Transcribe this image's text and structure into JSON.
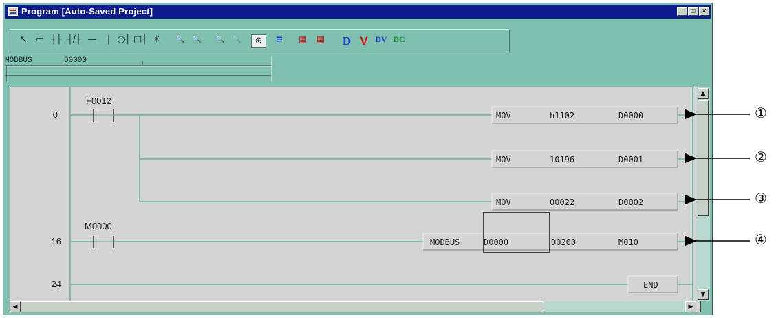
{
  "window": {
    "title": "Program  [Auto-Saved Project]",
    "controls": [
      "minimize-icon",
      "maximize-icon",
      "close-icon"
    ],
    "control_glyphs": [
      "_",
      "□",
      "×"
    ]
  },
  "toolbar": {
    "tools": [
      {
        "name": "select-pointer-icon",
        "glyph": "↖"
      },
      {
        "name": "box-select-icon",
        "glyph": "▭"
      },
      {
        "name": "no-contact-icon",
        "glyph": "┤├"
      },
      {
        "name": "nc-contact-icon",
        "glyph": "┤/├"
      },
      {
        "name": "horizontal-line-icon",
        "glyph": "—"
      },
      {
        "name": "vertical-line-icon",
        "glyph": "|"
      },
      {
        "name": "coil-icon",
        "glyph": "○┤"
      },
      {
        "name": "function-box-icon",
        "glyph": "□┤"
      },
      {
        "name": "invert-icon",
        "glyph": "✳"
      },
      {
        "name": "zoom-in-icon",
        "glyph": "🔍"
      },
      {
        "name": "zoom-out-icon",
        "glyph": "🔍"
      },
      {
        "name": "zoom-fit-icon",
        "glyph": "🔍"
      },
      {
        "name": "zoom-reset-icon",
        "glyph": "🔍"
      },
      {
        "name": "zoom-select-icon",
        "glyph": "⊕"
      },
      {
        "name": "comment-icon",
        "glyph": "≡"
      },
      {
        "name": "monitor-on-icon",
        "glyph": "▦"
      },
      {
        "name": "monitor-off-icon",
        "glyph": "▦"
      },
      {
        "name": "device-d-icon",
        "glyph": "D"
      },
      {
        "name": "device-v-icon",
        "glyph": "V"
      },
      {
        "name": "device-dv-icon",
        "glyph": "DV"
      },
      {
        "name": "device-dc-icon",
        "glyph": "DC"
      }
    ]
  },
  "mod_bar": {
    "instruction": "MODBUS",
    "operand": "D0000"
  },
  "ladder": {
    "rungs": [
      {
        "step": "0",
        "contact": "F0012",
        "instructions": [
          {
            "op": "MOV",
            "src": "h1102",
            "dst": "D0000"
          },
          {
            "op": "MOV",
            "src": "10196",
            "dst": "D0001"
          },
          {
            "op": "MOV",
            "src": "00022",
            "dst": "D0002"
          }
        ]
      },
      {
        "step": "16",
        "contact": "M0000",
        "instructions": [
          {
            "op": "MODBUS",
            "src": "D0000",
            "dst": "D0200",
            "ext": "M010"
          }
        ]
      },
      {
        "step": "24",
        "end": "END"
      }
    ]
  },
  "callouts": [
    "①",
    "②",
    "③",
    "④"
  ],
  "colors": {
    "window_bg": "#80c0b0",
    "titlebar": "#0c1c8c",
    "ladder_bg": "#d4d4d4",
    "rung_line": "#6aaea0"
  }
}
